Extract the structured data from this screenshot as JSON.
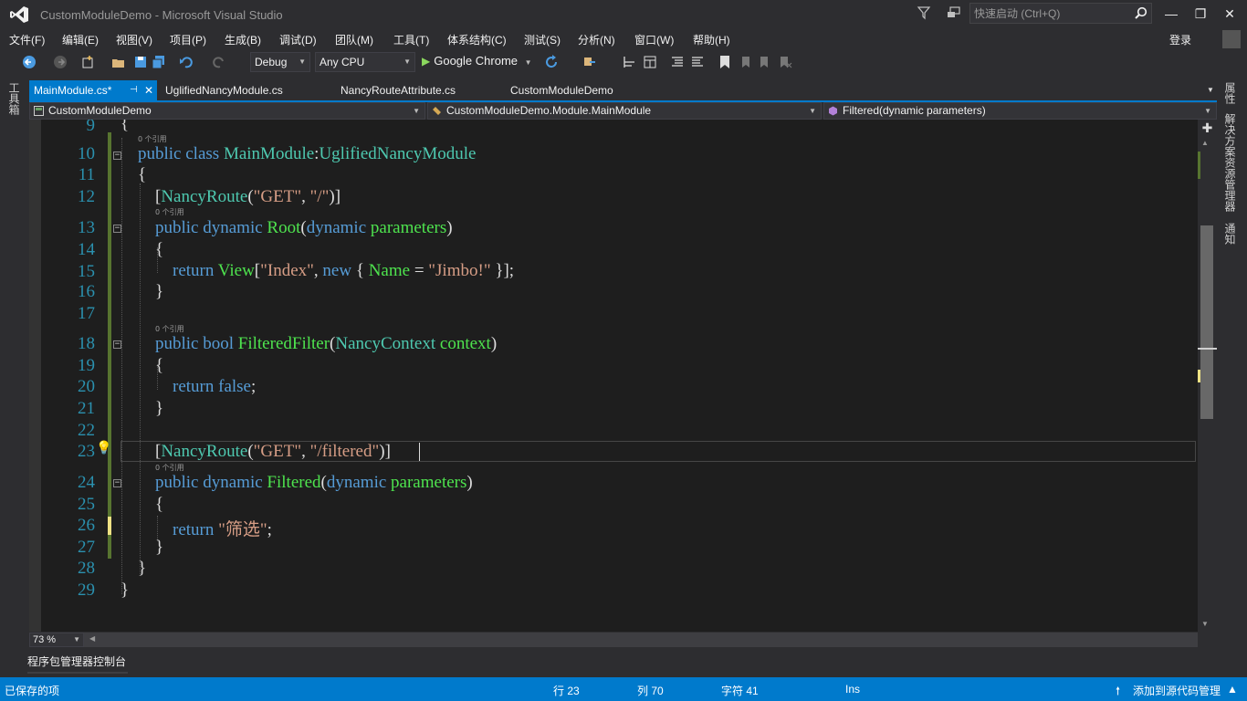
{
  "window": {
    "title": "CustomModuleDemo - Microsoft Visual Studio",
    "quick_launch_placeholder": "快速启动 (Ctrl+Q)",
    "sign_in": "登录",
    "minimize": "—",
    "maximize": "❐",
    "close": "✕"
  },
  "menu": [
    "文件(F)",
    "编辑(E)",
    "视图(V)",
    "项目(P)",
    "生成(B)",
    "调试(D)",
    "团队(M)",
    "工具(T)",
    "体系结构(C)",
    "测试(S)",
    "分析(N)",
    "窗口(W)",
    "帮助(H)"
  ],
  "toolbar": {
    "configuration": "Debug",
    "platform": "Any CPU",
    "run_target": "Google Chrome"
  },
  "side_panels": {
    "left": "工具箱",
    "right_properties": "属性",
    "right_solution": "解决方案资源管理器",
    "right_notifications": "通知"
  },
  "tabs": [
    {
      "label": "MainModule.cs*",
      "active": true
    },
    {
      "label": "UglifiedNancyModule.cs",
      "active": false
    },
    {
      "label": "NancyRouteAttribute.cs",
      "active": false
    },
    {
      "label": "CustomModuleDemo",
      "active": false
    }
  ],
  "navbar": {
    "project": "CustomModuleDemo",
    "type": "CustomModuleDemo.Module.MainModule",
    "member": "Filtered(dynamic parameters)"
  },
  "editor": {
    "line_numbers": [
      "9",
      "10",
      "11",
      "12",
      "13",
      "14",
      "15",
      "16",
      "17",
      "18",
      "19",
      "20",
      "21",
      "22",
      "23",
      "24",
      "25",
      "26",
      "27",
      "28",
      "29"
    ],
    "reference_hint": "0 个引用",
    "tokens": {
      "l9_brace": "{",
      "l10_public": "public class ",
      "l10_class": "MainModule",
      "l10_colon": ":",
      "l10_base": "UglifiedNancyModule",
      "l11": "{",
      "l12_open": "[",
      "l12_attr": "NancyRoute",
      "l12_paren": "(",
      "l12_get": "\"GET\"",
      "l12_comma": ", ",
      "l12_path": "\"/\"",
      "l12_close": ")]",
      "l13_mods": "public dynamic ",
      "l13_name": "Root",
      "l13_paren": "(",
      "l13_ptype": "dynamic ",
      "l13_pname": "parameters",
      "l13_close": ")",
      "l14": "{",
      "l15_return": "return ",
      "l15_view": "View",
      "l15_b1": "[",
      "l15_index": "\"Index\"",
      "l15_comma": ", ",
      "l15_new": "new",
      "l15_brace": " { ",
      "l15_name": "Name",
      "l15_eq": " = ",
      "l15_jimbo": "\"Jimbo!\"",
      "l15_end": " }];",
      "l16": "}",
      "l18_mods": "public bool ",
      "l18_name": "FilteredFilter",
      "l18_paren": "(",
      "l18_ptype": "NancyContext ",
      "l18_pname": "context",
      "l18_close": ")",
      "l19": "{",
      "l20_return": "return ",
      "l20_false": "false",
      "l20_semi": ";",
      "l21": "}",
      "l23_open": "[",
      "l23_attr": "NancyRoute",
      "l23_paren": "(",
      "l23_get": "\"GET\"",
      "l23_comma": ", ",
      "l23_path": "\"/filtered\"",
      "l23_close": ")]",
      "l24_mods": "public dynamic ",
      "l24_name": "Filtered",
      "l24_paren": "(",
      "l24_ptype": "dynamic ",
      "l24_pname": "parameters",
      "l24_close": ")",
      "l25": "{",
      "l26_return": "return ",
      "l26_str": "\"筛选\"",
      "l26_semi": ";",
      "l27": "}",
      "l28": "}",
      "l29": "}"
    }
  },
  "zoom": "73 %",
  "bottom_tab": "程序包管理器控制台",
  "status": {
    "message": "已保存的项",
    "row": "行 23",
    "col": "列 70",
    "char": "字符 41",
    "mode": "Ins",
    "source_control": "添加到源代码管理"
  },
  "colors": {
    "accent": "#007acc",
    "keyword": "#569cd6",
    "type": "#4ec9b0",
    "method": "#4ee34e",
    "string": "#d69d85",
    "line_number": "#2b91af"
  }
}
